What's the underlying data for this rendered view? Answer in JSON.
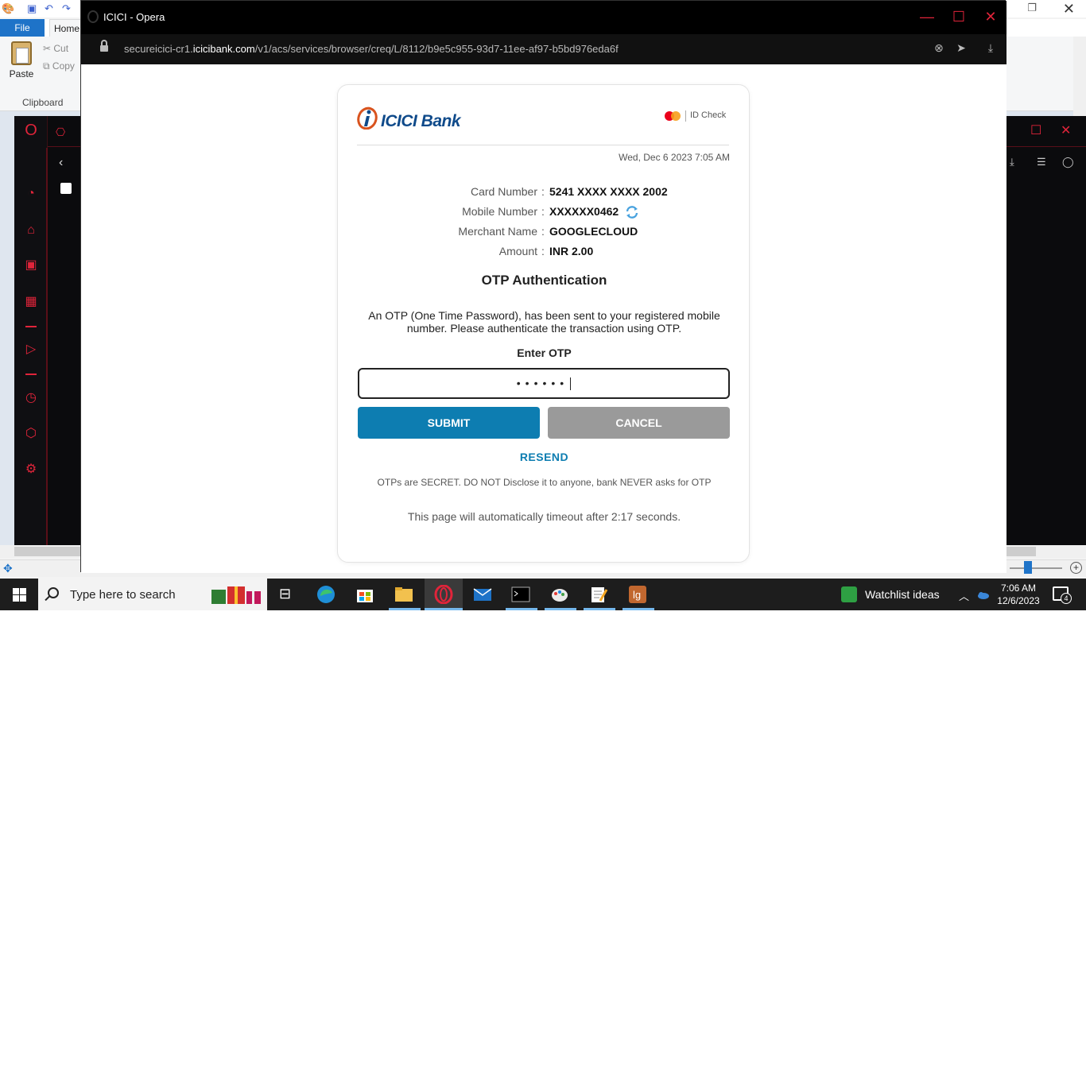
{
  "paint": {
    "tab_file": "File",
    "tab_home": "Home",
    "paste_label": "Paste",
    "cut_label": "Cut",
    "copy_label": "Copy",
    "clipboard_label": "Clipboard"
  },
  "popup": {
    "title": "ICICI - Opera",
    "url_prefix": "secureicici-cr1.",
    "url_domain": "icicibank.com",
    "url_path": "/v1/acs/services/browser/creq/L/8112/b9e5c955-93d7-11ee-af97-b5bd976eda6f"
  },
  "card": {
    "brand_name": "ICICI Bank",
    "id_check": "ID Check",
    "datetime": "Wed, Dec 6 2023 7:05 AM",
    "rows": [
      {
        "label": "Card Number",
        "sep": ":",
        "value": "5241 XXXX XXXX 2002"
      },
      {
        "label": "Mobile Number",
        "sep": ":",
        "value": "XXXXXX0462"
      },
      {
        "label": "Merchant Name",
        "sep": ":",
        "value": "GOOGLECLOUD"
      },
      {
        "label": "Amount",
        "sep": ":",
        "value": "INR 2.00"
      }
    ],
    "otp_title": "OTP Authentication",
    "otp_desc": "An OTP (One Time Password), has been sent to your registered mobile number. Please authenticate the transaction using OTP.",
    "enter_otp": "Enter OTP",
    "otp_value_masked": "••••••",
    "submit": "SUBMIT",
    "cancel": "CANCEL",
    "resend": "RESEND",
    "secret_note": "OTPs are SECRET. DO NOT Disclose it to anyone, bank NEVER asks for OTP",
    "timeout": "This page will automatically timeout after 2:17 seconds."
  },
  "taskbar": {
    "search_placeholder": "Type here to search",
    "watchlist": "Watchlist ideas",
    "time": "7:06 AM",
    "date": "12/6/2023",
    "notif_count": "4"
  },
  "colors": {
    "primary_blue": "#0d7db1",
    "cancel_gray": "#9a9a9a",
    "opera_red": "#e0243a",
    "brand_blue": "#0f4a8a",
    "brand_orange": "#d9531e"
  }
}
